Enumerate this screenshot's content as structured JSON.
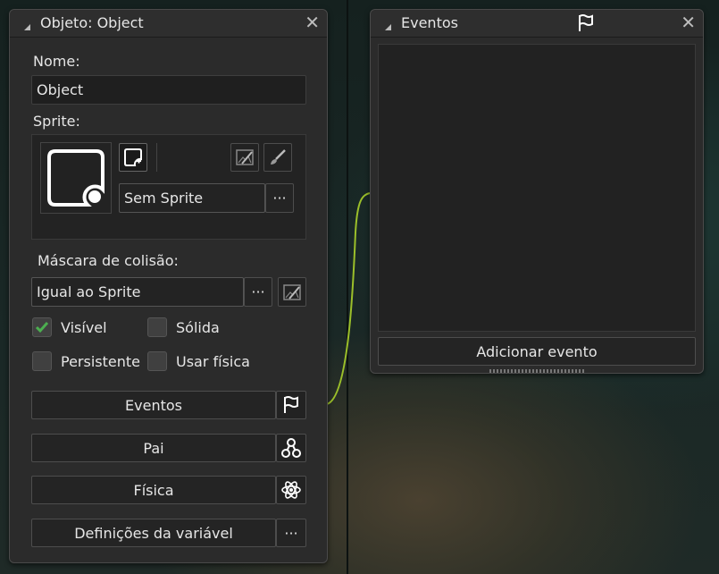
{
  "object_panel": {
    "title": "Objeto: Object",
    "name_label": "Nome:",
    "name_value": "Object",
    "sprite_label": "Sprite:",
    "sprite_value": "Sem Sprite",
    "sprite_browse": "···",
    "collision_label": "Máscara de colisão:",
    "collision_value": "Igual ao Sprite",
    "collision_browse": "···",
    "checks": {
      "visible": {
        "label": "Visível",
        "checked": true
      },
      "solid": {
        "label": "Sólida",
        "checked": false
      },
      "persistent": {
        "label": "Persistente",
        "checked": false
      },
      "physics": {
        "label": "Usar física",
        "checked": false
      }
    },
    "buttons": {
      "events": "Eventos",
      "parent": "Pai",
      "physics": "Física",
      "variables": "Definições da variável",
      "variables_more": "···"
    }
  },
  "events_panel": {
    "title": "Eventos",
    "add_event": "Adicionar evento"
  },
  "colors": {
    "accent_check": "#4caf50",
    "wire": "#9bbf2a",
    "panel_bg": "#2b2b2b"
  }
}
